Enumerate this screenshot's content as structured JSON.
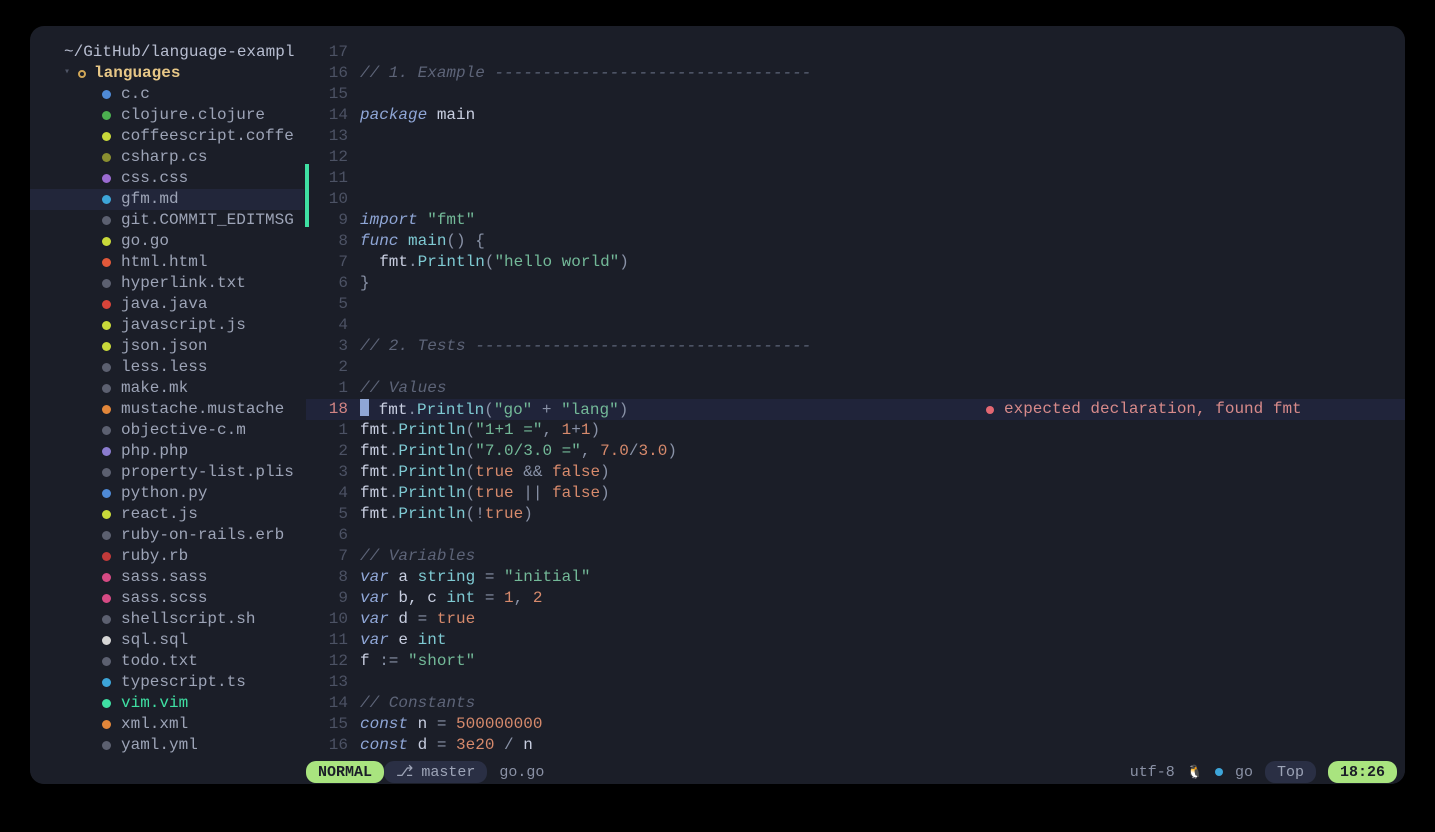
{
  "sidebar": {
    "title": "~/GitHub/language-exampl",
    "root": "languages",
    "files": [
      {
        "name": "c.c",
        "color": "#4f8ad6"
      },
      {
        "name": "clojure.clojure",
        "color": "#4caf50"
      },
      {
        "name": "coffeescript.coffe",
        "color": "#c9d93a"
      },
      {
        "name": "csharp.cs",
        "color": "#8a8f30"
      },
      {
        "name": "css.css",
        "color": "#9b6bd1"
      },
      {
        "name": "gfm.md",
        "color": "#3da5d9",
        "selected": true
      },
      {
        "name": "git.COMMIT_EDITMSG",
        "color": "#5c6070"
      },
      {
        "name": "go.go",
        "color": "#c9d93a"
      },
      {
        "name": "html.html",
        "color": "#e1583a"
      },
      {
        "name": "hyperlink.txt",
        "color": "#5c6070"
      },
      {
        "name": "java.java",
        "color": "#d8443a"
      },
      {
        "name": "javascript.js",
        "color": "#c9d93a"
      },
      {
        "name": "json.json",
        "color": "#c9d93a"
      },
      {
        "name": "less.less",
        "color": "#5c6070"
      },
      {
        "name": "make.mk",
        "color": "#5c6070"
      },
      {
        "name": "mustache.mustache",
        "color": "#e1863a"
      },
      {
        "name": "objective-c.m",
        "color": "#5c6070"
      },
      {
        "name": "php.php",
        "color": "#8b7ccf"
      },
      {
        "name": "property-list.plis",
        "color": "#5c6070"
      },
      {
        "name": "python.py",
        "color": "#4f8ad6"
      },
      {
        "name": "react.js",
        "color": "#c9d93a"
      },
      {
        "name": "ruby-on-rails.erb",
        "color": "#5c6070"
      },
      {
        "name": "ruby.rb",
        "color": "#c23a3a"
      },
      {
        "name": "sass.sass",
        "color": "#d64a84"
      },
      {
        "name": "sass.scss",
        "color": "#d64a84"
      },
      {
        "name": "shellscript.sh",
        "color": "#5c6070"
      },
      {
        "name": "sql.sql",
        "color": "#d6d6d6"
      },
      {
        "name": "todo.txt",
        "color": "#5c6070"
      },
      {
        "name": "typescript.ts",
        "color": "#3da5d9"
      },
      {
        "name": "vim.vim",
        "color": "#3fe0a3",
        "text_color": "#3fe0a3"
      },
      {
        "name": "xml.xml",
        "color": "#e1863a"
      },
      {
        "name": "yaml.yml",
        "color": "#5c6070"
      }
    ]
  },
  "editor": {
    "cursor_line": 18,
    "diagnostic": {
      "line_index": 18,
      "message": "expected declaration, found fmt"
    },
    "lines": [
      {
        "rel": "17",
        "tokens": []
      },
      {
        "rel": "16",
        "tokens": [
          {
            "c": "cmt",
            "t": "// 1. Example ---------------------------------"
          }
        ]
      },
      {
        "rel": "15",
        "tokens": []
      },
      {
        "rel": "14",
        "tokens": [
          {
            "c": "kw",
            "t": "package"
          },
          {
            "c": "id",
            "t": " main"
          }
        ]
      },
      {
        "rel": "13",
        "tokens": []
      },
      {
        "rel": "12",
        "tokens": []
      },
      {
        "rel": "11",
        "tokens": []
      },
      {
        "rel": "10",
        "tokens": []
      },
      {
        "rel": "9",
        "tokens": [
          {
            "c": "kw",
            "t": "import"
          },
          {
            "c": "id",
            "t": " "
          },
          {
            "c": "str",
            "t": "\"fmt\""
          }
        ]
      },
      {
        "rel": "8",
        "tokens": [
          {
            "c": "kw",
            "t": "func"
          },
          {
            "c": "id",
            "t": " "
          },
          {
            "c": "fn",
            "t": "main"
          },
          {
            "c": "op",
            "t": "() {"
          }
        ]
      },
      {
        "rel": "7",
        "tokens": [
          {
            "c": "id",
            "t": "  fmt"
          },
          {
            "c": "op",
            "t": "."
          },
          {
            "c": "fn",
            "t": "Println"
          },
          {
            "c": "op",
            "t": "("
          },
          {
            "c": "str",
            "t": "\"hello world\""
          },
          {
            "c": "op",
            "t": ")"
          }
        ]
      },
      {
        "rel": "6",
        "tokens": [
          {
            "c": "op",
            "t": "}"
          }
        ]
      },
      {
        "rel": "5",
        "tokens": []
      },
      {
        "rel": "4",
        "tokens": []
      },
      {
        "rel": "3",
        "tokens": [
          {
            "c": "cmt",
            "t": "// 2. Tests -----------------------------------"
          }
        ]
      },
      {
        "rel": "2",
        "tokens": []
      },
      {
        "rel": "1",
        "tokens": [
          {
            "c": "cmt",
            "t": "// Values"
          }
        ]
      },
      {
        "rel": "18",
        "current": true,
        "indent": " ",
        "tokens": [
          {
            "c": "id",
            "t": "fmt"
          },
          {
            "c": "op",
            "t": "."
          },
          {
            "c": "fn",
            "t": "Println"
          },
          {
            "c": "op",
            "t": "("
          },
          {
            "c": "str",
            "t": "\"go\""
          },
          {
            "c": "op",
            "t": " + "
          },
          {
            "c": "str",
            "t": "\"lang\""
          },
          {
            "c": "op",
            "t": ")"
          }
        ]
      },
      {
        "rel": "1",
        "tokens": [
          {
            "c": "id",
            "t": "fmt"
          },
          {
            "c": "op",
            "t": "."
          },
          {
            "c": "fn",
            "t": "Println"
          },
          {
            "c": "op",
            "t": "("
          },
          {
            "c": "str",
            "t": "\"1+1 =\""
          },
          {
            "c": "op",
            "t": ", "
          },
          {
            "c": "num",
            "t": "1"
          },
          {
            "c": "op",
            "t": "+"
          },
          {
            "c": "num",
            "t": "1"
          },
          {
            "c": "op",
            "t": ")"
          }
        ]
      },
      {
        "rel": "2",
        "tokens": [
          {
            "c": "id",
            "t": "fmt"
          },
          {
            "c": "op",
            "t": "."
          },
          {
            "c": "fn",
            "t": "Println"
          },
          {
            "c": "op",
            "t": "("
          },
          {
            "c": "str",
            "t": "\"7.0/3.0 =\""
          },
          {
            "c": "op",
            "t": ", "
          },
          {
            "c": "num",
            "t": "7.0"
          },
          {
            "c": "op",
            "t": "/"
          },
          {
            "c": "num",
            "t": "3.0"
          },
          {
            "c": "op",
            "t": ")"
          }
        ]
      },
      {
        "rel": "3",
        "tokens": [
          {
            "c": "id",
            "t": "fmt"
          },
          {
            "c": "op",
            "t": "."
          },
          {
            "c": "fn",
            "t": "Println"
          },
          {
            "c": "op",
            "t": "("
          },
          {
            "c": "bool",
            "t": "true"
          },
          {
            "c": "op",
            "t": " && "
          },
          {
            "c": "bool",
            "t": "false"
          },
          {
            "c": "op",
            "t": ")"
          }
        ]
      },
      {
        "rel": "4",
        "tokens": [
          {
            "c": "id",
            "t": "fmt"
          },
          {
            "c": "op",
            "t": "."
          },
          {
            "c": "fn",
            "t": "Println"
          },
          {
            "c": "op",
            "t": "("
          },
          {
            "c": "bool",
            "t": "true"
          },
          {
            "c": "op",
            "t": " || "
          },
          {
            "c": "bool",
            "t": "false"
          },
          {
            "c": "op",
            "t": ")"
          }
        ]
      },
      {
        "rel": "5",
        "tokens": [
          {
            "c": "id",
            "t": "fmt"
          },
          {
            "c": "op",
            "t": "."
          },
          {
            "c": "fn",
            "t": "Println"
          },
          {
            "c": "op",
            "t": "(!"
          },
          {
            "c": "bool",
            "t": "true"
          },
          {
            "c": "op",
            "t": ")"
          }
        ]
      },
      {
        "rel": "6",
        "tokens": []
      },
      {
        "rel": "7",
        "tokens": [
          {
            "c": "cmt",
            "t": "// Variables"
          }
        ]
      },
      {
        "rel": "8",
        "tokens": [
          {
            "c": "kw",
            "t": "var"
          },
          {
            "c": "id",
            "t": " a "
          },
          {
            "c": "fn",
            "t": "string"
          },
          {
            "c": "op",
            "t": " = "
          },
          {
            "c": "str",
            "t": "\"initial\""
          }
        ]
      },
      {
        "rel": "9",
        "tokens": [
          {
            "c": "kw",
            "t": "var"
          },
          {
            "c": "id",
            "t": " b, c "
          },
          {
            "c": "fn",
            "t": "int"
          },
          {
            "c": "op",
            "t": " = "
          },
          {
            "c": "num",
            "t": "1"
          },
          {
            "c": "op",
            "t": ", "
          },
          {
            "c": "num",
            "t": "2"
          }
        ]
      },
      {
        "rel": "10",
        "tokens": [
          {
            "c": "kw",
            "t": "var"
          },
          {
            "c": "id",
            "t": " d "
          },
          {
            "c": "op",
            "t": "= "
          },
          {
            "c": "bool",
            "t": "true"
          }
        ]
      },
      {
        "rel": "11",
        "tokens": [
          {
            "c": "kw",
            "t": "var"
          },
          {
            "c": "id",
            "t": " e "
          },
          {
            "c": "fn",
            "t": "int"
          }
        ]
      },
      {
        "rel": "12",
        "tokens": [
          {
            "c": "id",
            "t": "f "
          },
          {
            "c": "op",
            "t": ":= "
          },
          {
            "c": "str",
            "t": "\"short\""
          }
        ]
      },
      {
        "rel": "13",
        "tokens": []
      },
      {
        "rel": "14",
        "tokens": [
          {
            "c": "cmt",
            "t": "// Constants"
          }
        ]
      },
      {
        "rel": "15",
        "tokens": [
          {
            "c": "kw",
            "t": "const"
          },
          {
            "c": "id",
            "t": " n "
          },
          {
            "c": "op",
            "t": "= "
          },
          {
            "c": "num",
            "t": "500000000"
          }
        ]
      },
      {
        "rel": "16",
        "tokens": [
          {
            "c": "kw",
            "t": "const"
          },
          {
            "c": "id",
            "t": " d "
          },
          {
            "c": "op",
            "t": "= "
          },
          {
            "c": "num",
            "t": "3e20"
          },
          {
            "c": "op",
            "t": " / "
          },
          {
            "c": "id",
            "t": "n"
          }
        ]
      }
    ]
  },
  "status": {
    "mode": "NORMAL",
    "branch": "master",
    "file": "go.go",
    "encoding": "utf-8",
    "os_icon": "🐧",
    "filetype": "go",
    "position": "Top",
    "time": "18:26"
  }
}
